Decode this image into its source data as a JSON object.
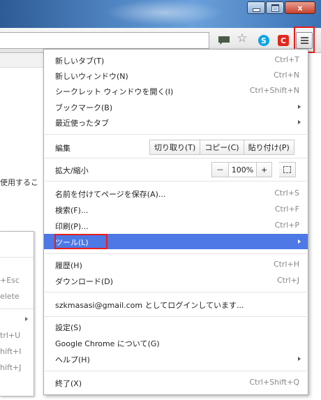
{
  "window": {
    "close_glyph": "x"
  },
  "toolbar": {
    "skype_letter": "S",
    "ext_letter": "C"
  },
  "page": {
    "partial_text": "使用するこ"
  },
  "submenu": {
    "items": [
      "+Esc",
      "elete",
      "trl+U",
      "hift+I",
      "hift+J"
    ]
  },
  "menu": {
    "items_top": [
      {
        "label": "新しいタブ(T)",
        "shortcut": "Ctrl+T"
      },
      {
        "label": "新しいウィンドウ(N)",
        "shortcut": "Ctrl+N"
      },
      {
        "label": "シークレット ウィンドウを開く(I)",
        "shortcut": "Ctrl+Shift+N"
      },
      {
        "label": "ブックマーク(B)"
      },
      {
        "label": "最近使ったタブ"
      }
    ],
    "edit": {
      "label": "編集",
      "cut": "切り取り(T)",
      "copy": "コピー(C)",
      "paste": "貼り付け(P)"
    },
    "zoom": {
      "label": "拡大/縮小",
      "minus": "－",
      "value": "100%",
      "plus": "+"
    },
    "items_mid": [
      {
        "label": "名前を付けてページを保存(A)...",
        "shortcut": "Ctrl+S"
      },
      {
        "label": "検索(F)...",
        "shortcut": "Ctrl+F"
      },
      {
        "label": "印刷(P)...",
        "shortcut": "Ctrl+P"
      },
      {
        "label": "ツール(L)"
      }
    ],
    "items_hist": [
      {
        "label": "履歴(H)",
        "shortcut": "Ctrl+H"
      },
      {
        "label": "ダウンロード(D)",
        "shortcut": "Ctrl+J"
      }
    ],
    "login": "szkmasasi@gmail.com としてログインしています...",
    "items_settings": [
      {
        "label": "設定(S)"
      },
      {
        "label": "Google Chrome について(G)"
      },
      {
        "label": "ヘルプ(H)"
      }
    ],
    "exit": {
      "label": "終了(X)",
      "shortcut": "Ctrl+Shift+Q"
    }
  },
  "colors": {
    "highlight": "#4d78e6",
    "annotation_red": "#e81c1c"
  }
}
